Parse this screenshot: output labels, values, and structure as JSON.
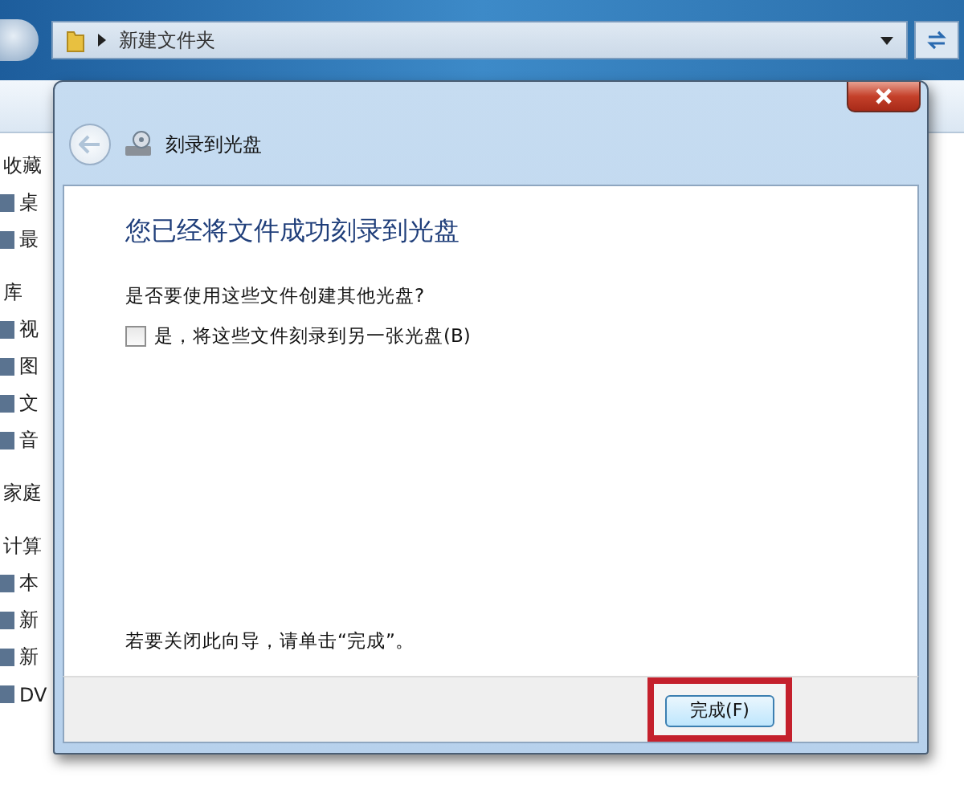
{
  "explorer": {
    "address": {
      "path": "新建文件夹"
    },
    "sidebar": [
      {
        "label": "收藏",
        "kind": "group"
      },
      {
        "label": "桌",
        "kind": "item"
      },
      {
        "label": "最",
        "kind": "item"
      },
      {
        "label": "库",
        "kind": "group"
      },
      {
        "label": "视",
        "kind": "item"
      },
      {
        "label": "图",
        "kind": "item"
      },
      {
        "label": "文",
        "kind": "item"
      },
      {
        "label": "音",
        "kind": "item"
      },
      {
        "label": "家庭",
        "kind": "group"
      },
      {
        "label": "计算",
        "kind": "group"
      },
      {
        "label": "本",
        "kind": "item"
      },
      {
        "label": "新",
        "kind": "item"
      },
      {
        "label": "新",
        "kind": "item"
      },
      {
        "label": "DV",
        "kind": "item"
      }
    ]
  },
  "dialog": {
    "title": "刻录到光盘",
    "heading": "您已经将文件成功刻录到光盘",
    "question": "是否要使用这些文件创建其他光盘?",
    "option": {
      "label": "是，将这些文件刻录到另一张光盘(B)",
      "checked": false
    },
    "footer_text": "若要关闭此向导，请单击“完成”。",
    "button": {
      "label": "完成(F)",
      "highlighted": true
    }
  }
}
